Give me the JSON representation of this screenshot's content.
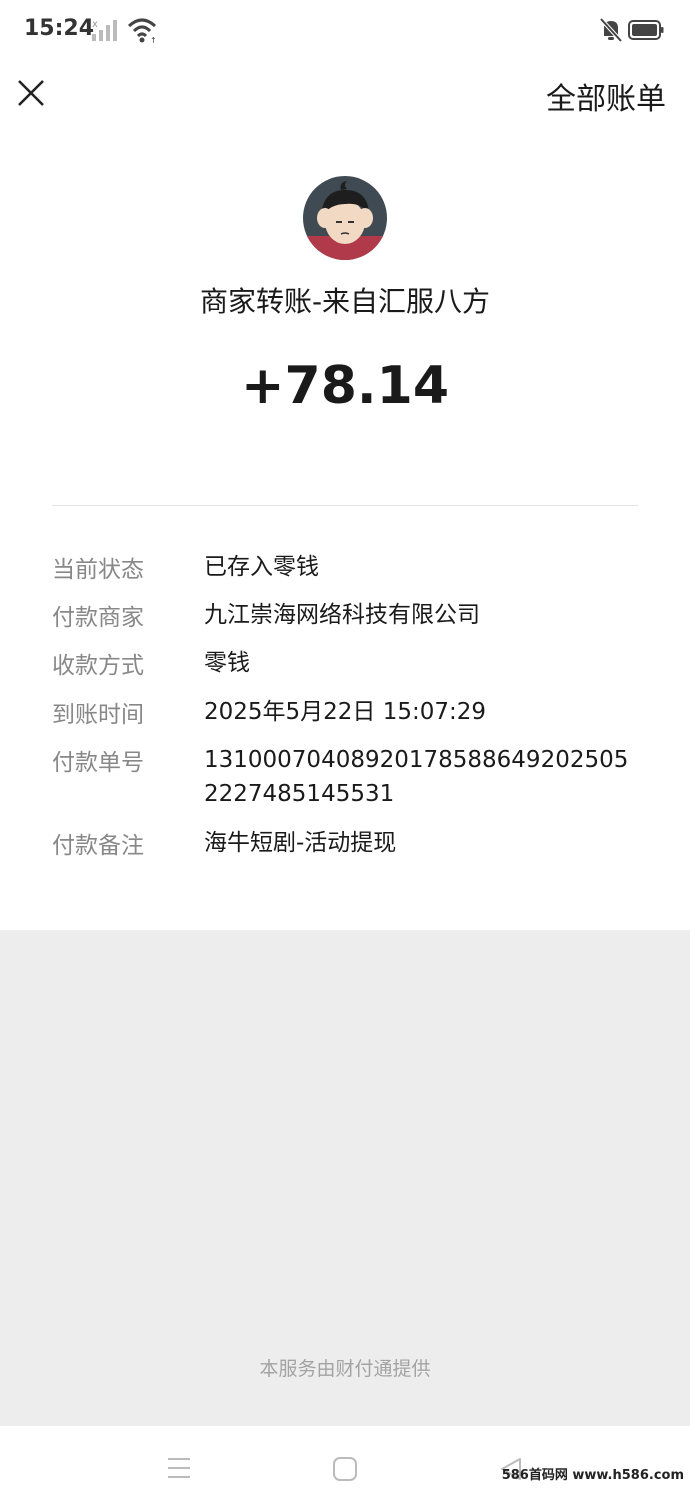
{
  "status_bar": {
    "time": "15:24"
  },
  "nav": {
    "all_bills_label": "全部账单"
  },
  "transfer": {
    "title": "商家转账-来自汇服八方",
    "amount": "+78.14"
  },
  "details": [
    {
      "label": "当前状态",
      "value": "已存入零钱"
    },
    {
      "label": "付款商家",
      "value": "九江崇海网络科技有限公司"
    },
    {
      "label": "收款方式",
      "value": "零钱"
    },
    {
      "label": "到账时间",
      "value": "2025年5月22日 15:07:29"
    },
    {
      "label": "付款单号",
      "value": "131000704089201785886492025052227485145531"
    },
    {
      "label": "付款备注",
      "value": "海牛短剧-活动提现"
    }
  ],
  "footer": {
    "note": "本服务由财付通提供"
  },
  "watermark": "586首码网 www.h586.com",
  "colors": {
    "text": "#1a1a1a",
    "label": "#888888",
    "background": "#ededed"
  }
}
